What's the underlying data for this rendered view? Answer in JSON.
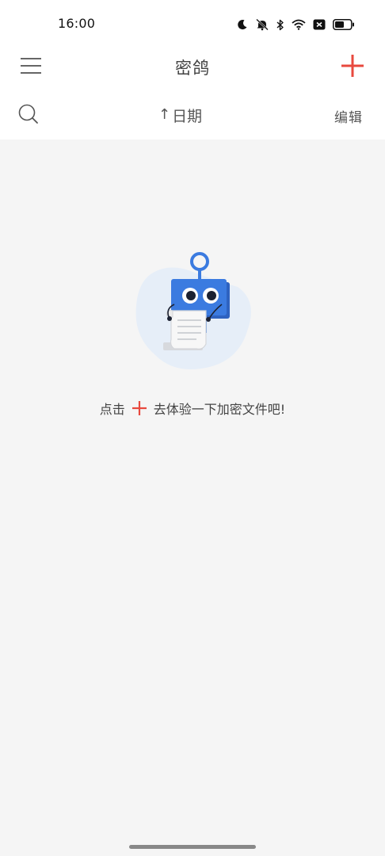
{
  "status_bar": {
    "time": "16:00",
    "icons": [
      "moon-icon",
      "silent-mode-icon",
      "bluetooth-icon",
      "wifi-icon",
      "notification-icon",
      "battery-icon"
    ]
  },
  "header": {
    "title": "密鸽",
    "menu_icon": "menu-icon",
    "add_icon": "plus-icon"
  },
  "toolbar": {
    "search_icon": "search-icon",
    "sort_arrow": "↑",
    "sort_label": "日期",
    "edit_label": "编辑"
  },
  "empty_state": {
    "message_prefix": "点击",
    "message_suffix": "去体验一下加密文件吧!"
  },
  "colors": {
    "accent": "#e8493e",
    "robot_blue": "#3b7be0",
    "blob_blue": "#e6eef8",
    "background": "#f5f5f5",
    "header_bg": "#ffffff"
  }
}
